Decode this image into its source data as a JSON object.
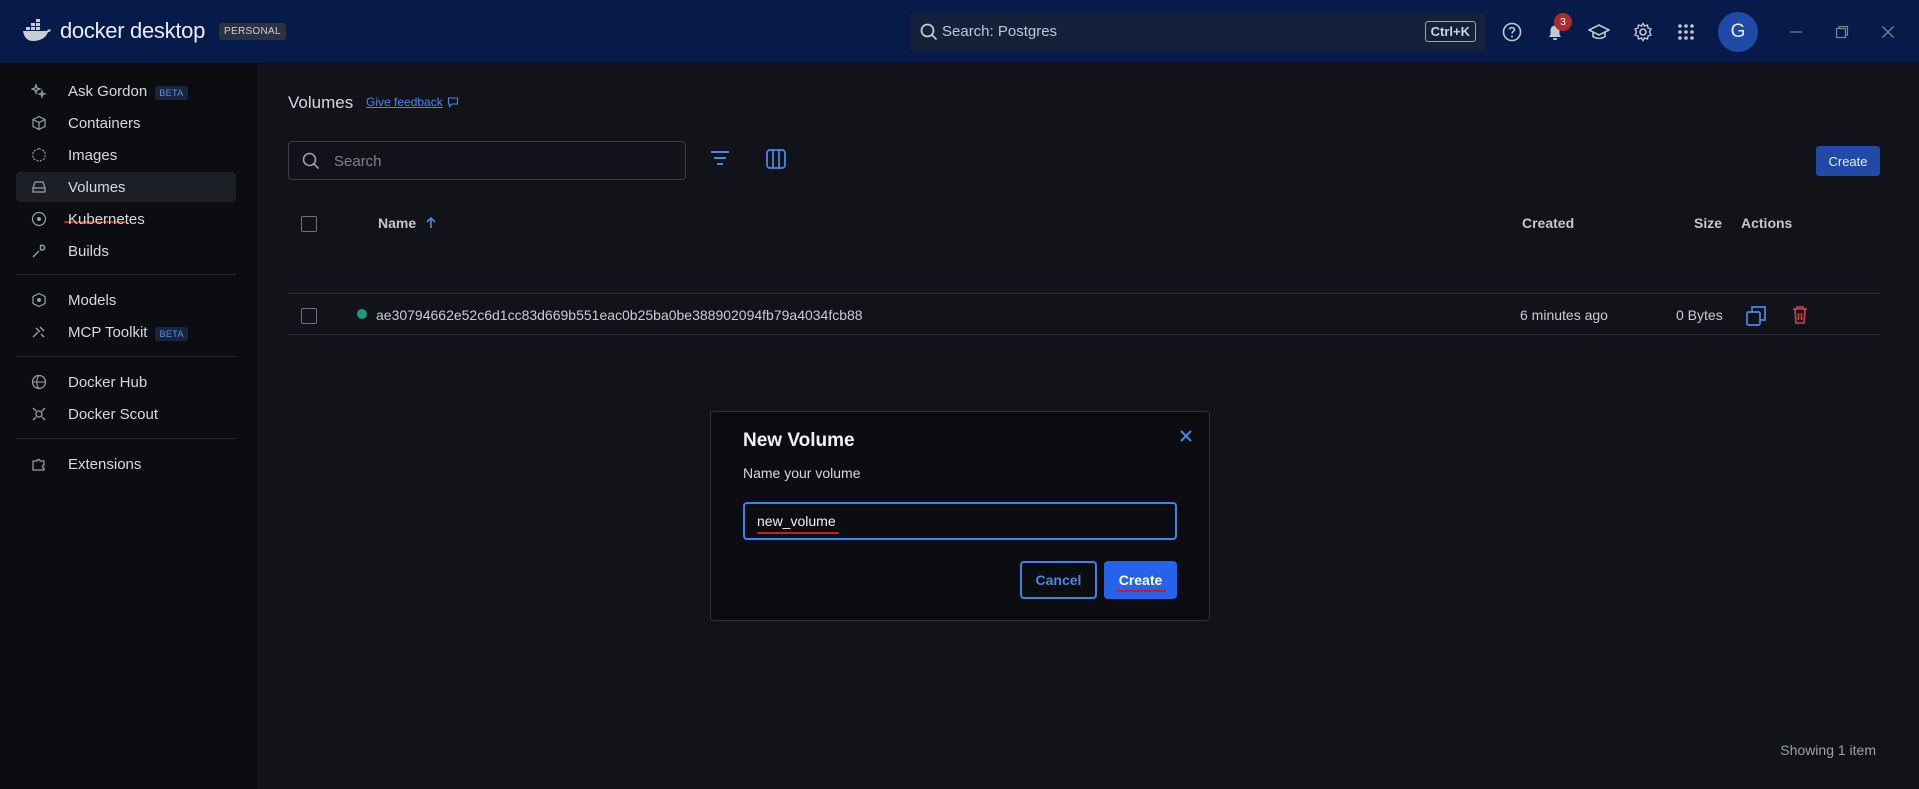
{
  "app": {
    "logo_text": "docker desktop",
    "plan_badge": "PERSONAL"
  },
  "topbar": {
    "search_text": "Search: Postgres",
    "search_shortcut": "Ctrl+K",
    "notification_count": "3",
    "avatar_initial": "G",
    "icons": [
      "help-icon",
      "bell-icon",
      "learning-center-icon",
      "settings-icon",
      "apps-grid-icon"
    ]
  },
  "sidebar": {
    "items": [
      {
        "label": "Ask Gordon",
        "badge": "BETA",
        "icon": "sparkle-icon"
      },
      {
        "label": "Containers",
        "icon": "container-icon"
      },
      {
        "label": "Images",
        "icon": "image-icon"
      },
      {
        "label": "Volumes",
        "icon": "volume-icon",
        "active": true
      },
      {
        "label": "Kubernetes",
        "icon": "kubernetes-icon"
      },
      {
        "label": "Builds",
        "icon": "wrench-icon"
      },
      {
        "label": "Models",
        "icon": "cube-icon"
      },
      {
        "label": "MCP Toolkit",
        "badge": "BETA",
        "icon": "toolkit-icon"
      },
      {
        "label": "Docker Hub",
        "icon": "globe-icon"
      },
      {
        "label": "Docker Scout",
        "icon": "scout-icon"
      },
      {
        "label": "Extensions",
        "icon": "puzzle-icon"
      }
    ]
  },
  "main": {
    "title": "Volumes",
    "feedback_link": "Give feedback",
    "search_placeholder": "Search",
    "create_label": "Create",
    "columns": {
      "name": "Name",
      "created": "Created",
      "size": "Size",
      "actions": "Actions"
    },
    "rows": [
      {
        "name": "ae30794662e52c6d1cc83d669b551eac0b25ba0be388902094fb79a4034fcb88",
        "created": "6 minutes ago",
        "size": "0 Bytes",
        "status_color": "#1f9a82"
      }
    ],
    "footer": "Showing 1 item"
  },
  "modal": {
    "title": "New Volume",
    "subtitle": "Name your volume",
    "input_value": "new_volume",
    "cancel_label": "Cancel",
    "create_label": "Create"
  },
  "colors": {
    "accent": "#2563eb",
    "topbar": "#061b4a",
    "annotation": "#d01b1b"
  }
}
